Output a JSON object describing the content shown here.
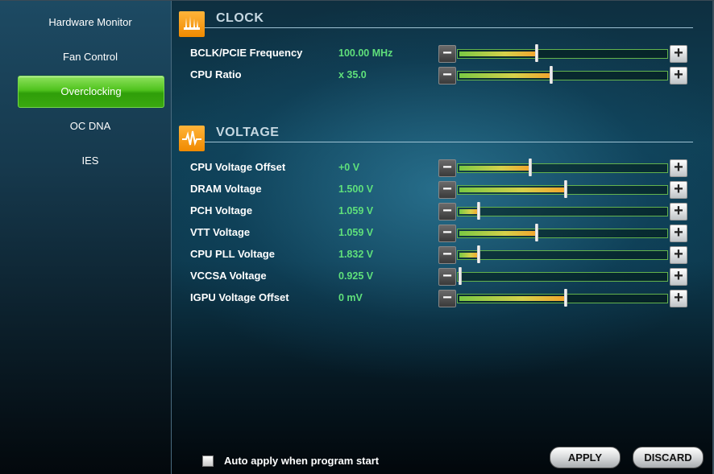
{
  "sidebar": {
    "items": [
      {
        "label": "Hardware Monitor",
        "active": false
      },
      {
        "label": "Fan Control",
        "active": false
      },
      {
        "label": "Overclocking",
        "active": true
      },
      {
        "label": "OC DNA",
        "active": false
      },
      {
        "label": "IES",
        "active": false
      }
    ]
  },
  "clock": {
    "title": "CLOCK",
    "icon": "clock-chart-icon",
    "rows": [
      {
        "label": "BCLK/PCIE Frequency",
        "value": "100.00 MHz",
        "level": 0.37
      },
      {
        "label": "CPU Ratio",
        "value": "x 35.0",
        "level": 0.44
      }
    ]
  },
  "voltage": {
    "title": "VOLTAGE",
    "icon": "waveform-icon",
    "rows": [
      {
        "label": "CPU Voltage Offset",
        "value": "+0 V",
        "level": 0.34
      },
      {
        "label": "DRAM Voltage",
        "value": "1.500 V",
        "level": 0.51
      },
      {
        "label": "PCH Voltage",
        "value": "1.059 V",
        "level": 0.09
      },
      {
        "label": "VTT Voltage",
        "value": "1.059 V",
        "level": 0.37
      },
      {
        "label": "CPU PLL Voltage",
        "value": "1.832 V",
        "level": 0.09
      },
      {
        "label": "VCCSA Voltage",
        "value": "0.925 V",
        "level": 0.0
      },
      {
        "label": "IGPU Voltage Offset",
        "value": "0 mV",
        "level": 0.51
      }
    ]
  },
  "footer": {
    "auto_apply_label": "Auto apply when program start",
    "auto_apply_checked": false,
    "apply_label": "APPLY",
    "discard_label": "DISCARD"
  },
  "colors": {
    "accent_green": "#4fc21d",
    "value_green": "#5fe07b",
    "section_icon_orange": "#f08a00"
  }
}
